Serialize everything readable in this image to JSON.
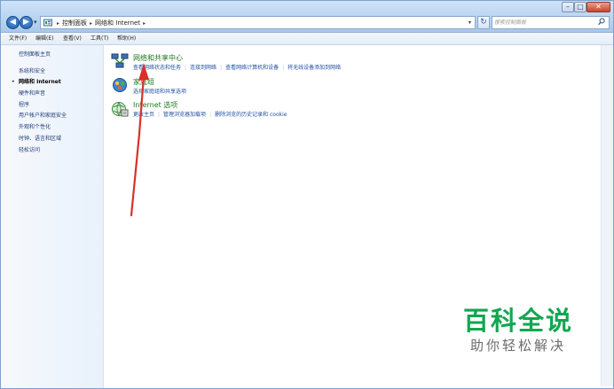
{
  "window": {
    "caption_buttons": {
      "minimize": "–",
      "maximize": "□",
      "close": "✕"
    },
    "navigation": {
      "back": "◀",
      "forward": "▶",
      "history": "▾"
    }
  },
  "address_bar": {
    "icon": "control-panel-icon",
    "breadcrumb": [
      "控制面板",
      "网络和 Internet"
    ],
    "dropdown": "▾",
    "refresh": "↻"
  },
  "search": {
    "placeholder": "搜索控制面板",
    "icon": "search-icon"
  },
  "menubar": {
    "items": [
      "文件(F)",
      "编辑(E)",
      "查看(V)",
      "工具(T)",
      "帮助(H)"
    ]
  },
  "sidebar": {
    "items": [
      {
        "label": "控制面板主页",
        "current": false
      },
      {
        "label": "系统和安全",
        "current": false
      },
      {
        "label": "网络和 Internet",
        "current": true
      },
      {
        "label": "硬件和声音",
        "current": false
      },
      {
        "label": "程序",
        "current": false
      },
      {
        "label": "用户帐户和家庭安全",
        "current": false
      },
      {
        "label": "外观和个性化",
        "current": false
      },
      {
        "label": "时钟、语言和区域",
        "current": false
      },
      {
        "label": "轻松访问",
        "current": false
      }
    ],
    "current_marker": "•"
  },
  "categories": [
    {
      "title": "网络和共享中心",
      "icon": "network-sharing-center-icon",
      "tasks": [
        "查看网络状态和任务",
        "连接到网络",
        "查看网络计算机和设备",
        "将无线设备添加到网络"
      ]
    },
    {
      "title": "家庭组",
      "icon": "homegroup-icon",
      "tasks": [
        "选择家庭组和共享选项"
      ]
    },
    {
      "title": "Internet 选项",
      "icon": "internet-options-icon",
      "tasks": [
        "更改主页",
        "管理浏览器加载项",
        "删除浏览的历史记录和 cookie"
      ]
    }
  ],
  "task_separator": "|",
  "watermark": {
    "logo": "百科全说",
    "tagline": "助你轻松解决"
  },
  "colors": {
    "category_title": "#1c7a1c",
    "task_link": "#1f4fa6",
    "sidebar_link": "#1e3c78",
    "annotation_arrow": "#d9302a",
    "watermark_green": "#12a650"
  }
}
